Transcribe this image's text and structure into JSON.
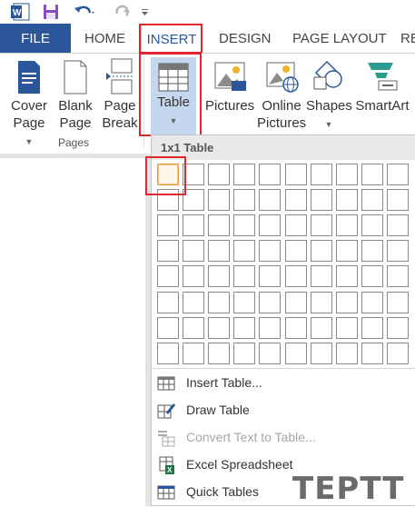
{
  "quick_access": {
    "icons": [
      "word-icon",
      "save-icon",
      "undo-icon",
      "redo-icon",
      "customize-icon"
    ]
  },
  "tabs": [
    {
      "label": "FILE"
    },
    {
      "label": "HOME"
    },
    {
      "label": "INSERT",
      "active": true
    },
    {
      "label": "DESIGN"
    },
    {
      "label": "PAGE LAYOUT"
    },
    {
      "label": "RE"
    }
  ],
  "ribbon": {
    "pages_group": {
      "label": "Pages",
      "buttons": [
        {
          "line1": "Cover",
          "line2": "Page"
        },
        {
          "line1": "Blank",
          "line2": "Page"
        },
        {
          "line1": "Page",
          "line2": "Break"
        }
      ]
    },
    "table_button": {
      "label": "Table"
    },
    "pictures_button": {
      "label": "Pictures"
    },
    "online_pictures_button": {
      "line1": "Online",
      "line2": "Pictures"
    },
    "shapes_button": {
      "label": "Shapes"
    },
    "smartart_button": {
      "label": "SmartArt"
    }
  },
  "table_dropdown": {
    "header": "1x1 Table",
    "grid_rows": 8,
    "grid_cols": 10,
    "selected_rows": 1,
    "selected_cols": 1,
    "menu_items": [
      {
        "label": "Insert Table...",
        "icon": "insert-table-icon",
        "enabled": true
      },
      {
        "label": "Draw Table",
        "icon": "draw-table-icon",
        "enabled": true
      },
      {
        "label": "Convert Text to Table...",
        "icon": "convert-text-icon",
        "enabled": false
      },
      {
        "label": "Excel Spreadsheet",
        "icon": "excel-icon",
        "enabled": true
      },
      {
        "label": "Quick Tables",
        "icon": "quick-tables-icon",
        "enabled": true
      }
    ]
  },
  "watermark": "TEPTT",
  "colors": {
    "accent": "#2b579a",
    "highlight_box": "#e0262e",
    "selected_cell": "#e89a3c"
  }
}
